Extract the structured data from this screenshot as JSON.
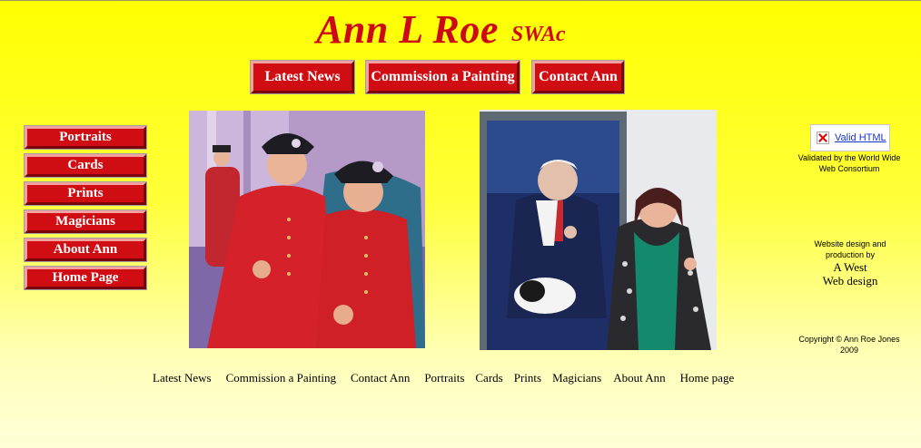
{
  "header": {
    "name": "Ann L Roe",
    "suffix": "SWAc"
  },
  "top_nav": [
    {
      "label": "Latest News"
    },
    {
      "label": "Commission a Painting"
    },
    {
      "label": "Contact Ann"
    }
  ],
  "side_nav": [
    {
      "label": "Portraits"
    },
    {
      "label": "Cards"
    },
    {
      "label": "Prints"
    },
    {
      "label": "Magicians"
    },
    {
      "label": "About Ann"
    },
    {
      "label": "Home Page"
    }
  ],
  "right_panel": {
    "badge_text": "Valid HTML",
    "badge_caption": "Validated by the World Wide Web Consortium",
    "design_caption": "Website design and production by",
    "designer_line1": "A West",
    "designer_line2": "Web design",
    "copyright": "Copyright © Ann Roe Jones 2009"
  },
  "footer_links": [
    {
      "label": "Latest News"
    },
    {
      "label": "Commission a Painting"
    },
    {
      "label": "Contact Ann"
    },
    {
      "label": "Portraits"
    },
    {
      "label": "Cards"
    },
    {
      "label": "Prints"
    },
    {
      "label": "Magicians"
    },
    {
      "label": "About Ann"
    },
    {
      "label": "Home page"
    }
  ],
  "colors": {
    "accent": "#d10d14",
    "background": "#ffff00"
  }
}
